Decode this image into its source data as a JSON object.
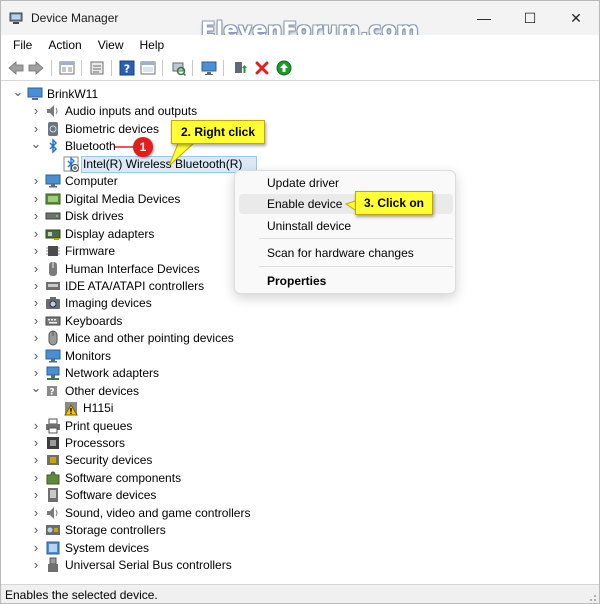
{
  "window": {
    "title": "Device Manager",
    "watermark": "ElevenForum.com",
    "minimize": "—",
    "maximize": "☐",
    "close": "✕"
  },
  "menu": [
    "File",
    "Action",
    "View",
    "Help"
  ],
  "toolbar": [
    "back-arrow",
    "forward-arrow",
    "properties",
    "show-hidden",
    "help",
    "view",
    "scan-hardware",
    "monitor",
    "update-driver",
    "uninstall",
    "enable"
  ],
  "tree": {
    "root": "BrinkW11",
    "categories": [
      {
        "label": "Audio inputs and outputs",
        "icon": "speaker-icon",
        "expanded": false
      },
      {
        "label": "Biometric devices",
        "icon": "fingerprint-icon",
        "expanded": false
      },
      {
        "label": "Bluetooth",
        "icon": "bluetooth-icon",
        "expanded": true,
        "children": [
          {
            "label": "Intel(R) Wireless Bluetooth(R)",
            "icon": "bluetooth-disabled-icon",
            "selected": true
          }
        ]
      },
      {
        "label": "Computer",
        "icon": "monitor-icon",
        "expanded": false
      },
      {
        "label": "Digital Media Devices",
        "icon": "media-icon",
        "expanded": false
      },
      {
        "label": "Disk drives",
        "icon": "disk-icon",
        "expanded": false
      },
      {
        "label": "Display adapters",
        "icon": "display-adapter-icon",
        "expanded": false
      },
      {
        "label": "Firmware",
        "icon": "chip-icon",
        "expanded": false
      },
      {
        "label": "Human Interface Devices",
        "icon": "hid-icon",
        "expanded": false
      },
      {
        "label": "IDE ATA/ATAPI controllers",
        "icon": "ide-icon",
        "expanded": false
      },
      {
        "label": "Imaging devices",
        "icon": "camera-icon",
        "expanded": false
      },
      {
        "label": "Keyboards",
        "icon": "keyboard-icon",
        "expanded": false
      },
      {
        "label": "Mice and other pointing devices",
        "icon": "mouse-icon",
        "expanded": false
      },
      {
        "label": "Monitors",
        "icon": "monitor-icon",
        "expanded": false
      },
      {
        "label": "Network adapters",
        "icon": "network-icon",
        "expanded": false
      },
      {
        "label": "Other devices",
        "icon": "unknown-device-icon",
        "expanded": true,
        "children": [
          {
            "label": "H115i",
            "icon": "warning-device-icon",
            "selected": false
          }
        ]
      },
      {
        "label": "Print queues",
        "icon": "printer-icon",
        "expanded": false
      },
      {
        "label": "Processors",
        "icon": "processor-icon",
        "expanded": false
      },
      {
        "label": "Security devices",
        "icon": "security-icon",
        "expanded": false
      },
      {
        "label": "Software components",
        "icon": "puzzle-icon",
        "expanded": false
      },
      {
        "label": "Software devices",
        "icon": "software-device-icon",
        "expanded": false
      },
      {
        "label": "Sound, video and game controllers",
        "icon": "speaker-icon",
        "expanded": false
      },
      {
        "label": "Storage controllers",
        "icon": "storage-icon",
        "expanded": false
      },
      {
        "label": "System devices",
        "icon": "system-icon",
        "expanded": false
      },
      {
        "label": "Universal Serial Bus controllers",
        "icon": "usb-icon",
        "expanded": false
      }
    ]
  },
  "context_menu": {
    "items": [
      {
        "label": "Update driver",
        "bold": false,
        "highlighted": false
      },
      {
        "label": "Enable device",
        "bold": false,
        "highlighted": true
      },
      {
        "label": "Uninstall device",
        "bold": false,
        "highlighted": false
      },
      {
        "label": "Scan for hardware changes",
        "bold": false,
        "highlighted": false
      },
      {
        "label": "Properties",
        "bold": true,
        "highlighted": false
      }
    ]
  },
  "callouts": {
    "step1_badge": "1",
    "step2": "2. Right click",
    "step3": "3. Click on"
  },
  "status": "Enables the selected device.",
  "colors": {
    "callout": "#ffff33",
    "badge": "#e31d1d",
    "selection": "#dbe9f7",
    "bluetooth": "#1f73d9",
    "disable_x": "#e01f1f",
    "enable_green": "#1d9b2b"
  }
}
